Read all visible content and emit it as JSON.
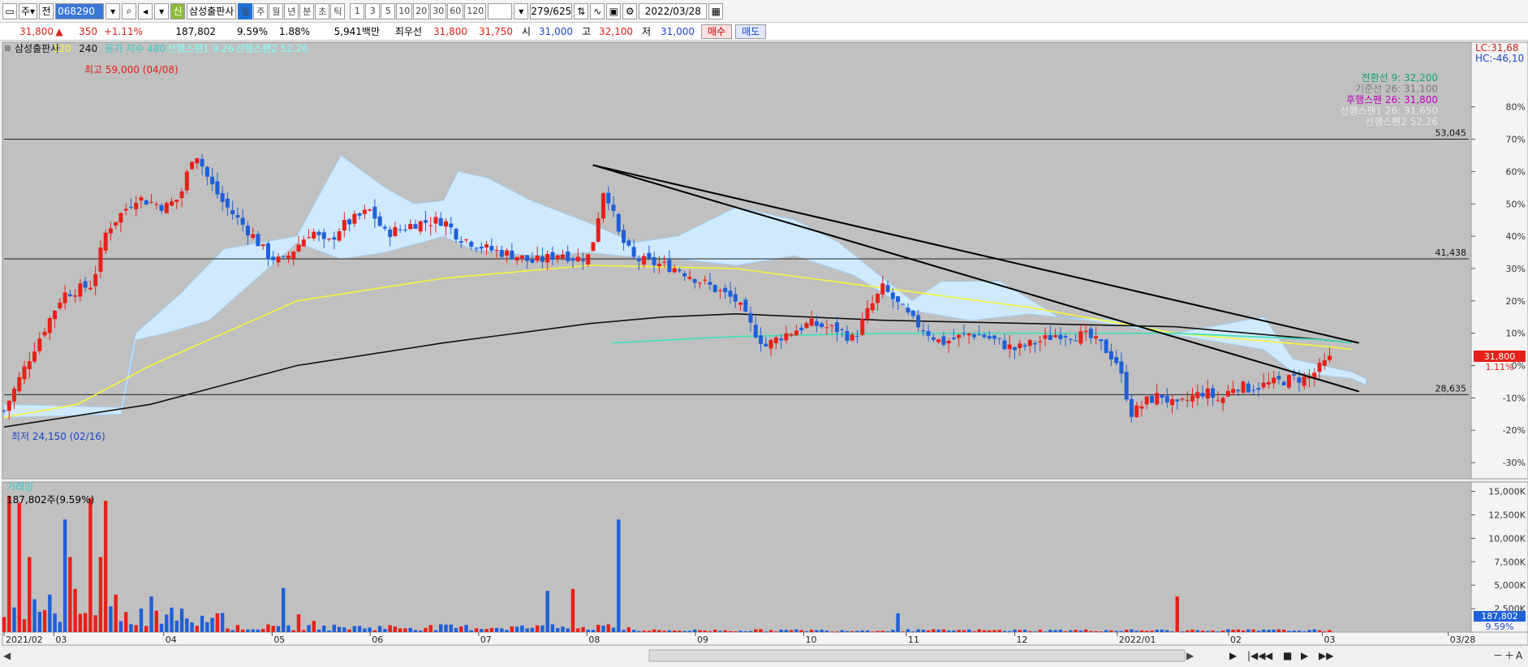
{
  "toolbar": {
    "period_main": "주",
    "all_btn": "전",
    "stock_code": "068290",
    "credit_badge": "신",
    "stock_name": "삼성출판사",
    "periods": [
      "일",
      "주",
      "월",
      "년",
      "분",
      "초",
      "틱"
    ],
    "active_period": "일",
    "intervals": [
      "1",
      "3",
      "5",
      "10",
      "20",
      "30",
      "60",
      "120"
    ],
    "range": "279/625",
    "date": "2022/03/28"
  },
  "quote": {
    "price": "31,800",
    "change": "350",
    "change_pct": "+1.11%",
    "volume": "187,802",
    "turnover_pct": "9.59%",
    "vol_ratio": "1.88%",
    "amount": "5,941백만",
    "priority_label": "최우선",
    "ask": "31,800",
    "bid": "31,750",
    "open_label": "시",
    "open": "31,000",
    "high_label": "고",
    "high": "32,100",
    "low_label": "저",
    "low": "31,000",
    "buy_label": "매수",
    "sell_label": "매도"
  },
  "colors": {
    "up": "#e8201a",
    "down": "#1f5fd8",
    "panel": "#c0c0c0",
    "cloud": "#cfe9ff",
    "ma120": "#f5f53c",
    "ma240": "#111111",
    "ma_eq": "#3ce0b8",
    "legend_cloud": "#80ffff"
  },
  "chart_data": {
    "type": "candlestick",
    "price_panel": {
      "legend": [
        "삼성출판사",
        "120",
        "240",
        "등가 지수 480",
        "선행스팬1 9.26",
        "선행스팬2 52.26"
      ],
      "ylim_pct": [
        -35,
        100
      ],
      "right_ticks": [
        "80%",
        "70%",
        "60%",
        "50%",
        "40%",
        "30%",
        "20%",
        "10%",
        "0%",
        "-10%",
        "-20%",
        "-30%"
      ],
      "corner_labels": [
        "LC:31,68",
        "HC:-46,10"
      ],
      "horizontal_lines": [
        {
          "label": "53,045",
          "pct": 70
        },
        {
          "label": "41,438",
          "pct": 33
        },
        {
          "label": "28,635",
          "pct": -9
        }
      ],
      "ichimoku_text": [
        {
          "text": "전환선 9: 32,200",
          "color": "#16a070"
        },
        {
          "text": "기준선 26: 31,100",
          "color": "#7a7a7a"
        },
        {
          "text": "후행스팬 26: 31,800",
          "color": "#c000c0"
        },
        {
          "text": "선행스팬1 26: 31,650",
          "color": "#e8e8e8"
        },
        {
          "text": "선행스팬2 52,26",
          "color": "#e8e8e8"
        }
      ],
      "annotations": {
        "high": "최고 59,000 (04/08)",
        "low": "최저 24,150 (02/16)"
      },
      "current": {
        "price": "31,800",
        "pct": "1.11%"
      },
      "trendlines": [
        [
          0.402,
          62,
          0.925,
          -8
        ],
        [
          0.402,
          62,
          0.925,
          7
        ]
      ],
      "anchors": [
        [
          0,
          -14
        ],
        [
          0.02,
          5
        ],
        [
          0.04,
          22
        ],
        [
          0.06,
          25
        ],
        [
          0.07,
          42
        ],
        [
          0.09,
          52
        ],
        [
          0.11,
          49
        ],
        [
          0.12,
          52
        ],
        [
          0.13,
          67
        ],
        [
          0.14,
          57
        ],
        [
          0.15,
          50
        ],
        [
          0.17,
          40
        ],
        [
          0.18,
          34
        ],
        [
          0.19,
          32
        ],
        [
          0.21,
          42
        ],
        [
          0.22,
          37
        ],
        [
          0.23,
          43
        ],
        [
          0.25,
          48
        ],
        [
          0.26,
          41
        ],
        [
          0.27,
          42
        ],
        [
          0.28,
          44
        ],
        [
          0.3,
          45
        ],
        [
          0.31,
          40
        ],
        [
          0.32,
          38
        ],
        [
          0.33,
          36
        ],
        [
          0.35,
          34
        ],
        [
          0.36,
          32
        ],
        [
          0.37,
          33
        ],
        [
          0.38,
          35
        ],
        [
          0.39,
          33
        ],
        [
          0.4,
          34
        ],
        [
          0.41,
          56
        ],
        [
          0.42,
          40
        ],
        [
          0.43,
          33
        ],
        [
          0.46,
          30
        ],
        [
          0.48,
          25
        ],
        [
          0.5,
          20
        ],
        [
          0.51,
          12
        ],
        [
          0.52,
          6
        ],
        [
          0.53,
          9
        ],
        [
          0.55,
          13
        ],
        [
          0.57,
          11
        ],
        [
          0.58,
          8
        ],
        [
          0.59,
          17
        ],
        [
          0.6,
          24
        ],
        [
          0.61,
          19
        ],
        [
          0.62,
          14
        ],
        [
          0.64,
          7
        ],
        [
          0.66,
          10
        ],
        [
          0.67,
          9
        ],
        [
          0.69,
          5
        ],
        [
          0.71,
          8
        ],
        [
          0.72,
          10
        ],
        [
          0.74,
          9
        ],
        [
          0.75,
          6
        ],
        [
          0.76,
          1
        ],
        [
          0.77,
          -15
        ],
        [
          0.78,
          -11
        ],
        [
          0.79,
          -9
        ],
        [
          0.8,
          -13
        ],
        [
          0.81,
          -10
        ],
        [
          0.82,
          -8
        ],
        [
          0.83,
          -11
        ],
        [
          0.84,
          -6
        ],
        [
          0.85,
          -7
        ],
        [
          0.87,
          -5
        ],
        [
          0.88,
          -4
        ],
        [
          0.89,
          -4
        ],
        [
          0.895,
          -2
        ],
        [
          0.905,
          2
        ]
      ],
      "ma120": [
        [
          0,
          -16
        ],
        [
          0.05,
          -12
        ],
        [
          0.1,
          0
        ],
        [
          0.15,
          10
        ],
        [
          0.2,
          20
        ],
        [
          0.3,
          27
        ],
        [
          0.4,
          31
        ],
        [
          0.5,
          30
        ],
        [
          0.6,
          24
        ],
        [
          0.7,
          18
        ],
        [
          0.75,
          14
        ],
        [
          0.8,
          10
        ],
        [
          0.85,
          8
        ],
        [
          0.9,
          6
        ],
        [
          0.92,
          5
        ]
      ],
      "ma240": [
        [
          0,
          -19
        ],
        [
          0.1,
          -12
        ],
        [
          0.15,
          -6
        ],
        [
          0.2,
          0
        ],
        [
          0.3,
          7
        ],
        [
          0.4,
          13
        ],
        [
          0.45,
          15
        ],
        [
          0.5,
          16
        ],
        [
          0.6,
          14
        ],
        [
          0.7,
          13
        ],
        [
          0.8,
          12
        ],
        [
          0.85,
          10
        ],
        [
          0.9,
          8
        ],
        [
          0.92,
          7
        ]
      ],
      "ma_eq": [
        [
          0.415,
          7
        ],
        [
          0.5,
          9
        ],
        [
          0.6,
          10
        ],
        [
          0.7,
          10
        ],
        [
          0.75,
          10
        ],
        [
          0.8,
          10
        ],
        [
          0.85,
          9
        ],
        [
          0.9,
          8
        ],
        [
          0.92,
          7
        ]
      ],
      "cloud_top": [
        [
          0,
          -12
        ],
        [
          0.08,
          -13
        ],
        [
          0.09,
          10
        ],
        [
          0.12,
          22
        ],
        [
          0.15,
          36
        ],
        [
          0.2,
          40
        ],
        [
          0.23,
          65
        ],
        [
          0.26,
          55
        ],
        [
          0.28,
          50
        ],
        [
          0.3,
          51
        ],
        [
          0.31,
          60
        ],
        [
          0.33,
          58
        ],
        [
          0.36,
          51
        ],
        [
          0.4,
          44
        ],
        [
          0.43,
          38
        ],
        [
          0.46,
          40
        ],
        [
          0.5,
          49
        ],
        [
          0.54,
          45
        ],
        [
          0.57,
          38
        ],
        [
          0.6,
          27
        ],
        [
          0.62,
          20
        ],
        [
          0.64,
          26
        ],
        [
          0.68,
          26
        ],
        [
          0.72,
          15
        ],
        [
          0.76,
          14
        ],
        [
          0.8,
          10
        ],
        [
          0.86,
          15
        ],
        [
          0.88,
          2
        ],
        [
          0.92,
          -2
        ],
        [
          0.93,
          -4
        ]
      ],
      "cloud_bot": [
        [
          0,
          -16
        ],
        [
          0.08,
          -15
        ],
        [
          0.09,
          8
        ],
        [
          0.11,
          10
        ],
        [
          0.14,
          14
        ],
        [
          0.2,
          38
        ],
        [
          0.23,
          33
        ],
        [
          0.26,
          35
        ],
        [
          0.3,
          40
        ],
        [
          0.32,
          36
        ],
        [
          0.36,
          34
        ],
        [
          0.4,
          35
        ],
        [
          0.42,
          34
        ],
        [
          0.46,
          33
        ],
        [
          0.5,
          31
        ],
        [
          0.54,
          34
        ],
        [
          0.58,
          28
        ],
        [
          0.62,
          17
        ],
        [
          0.66,
          14
        ],
        [
          0.7,
          16
        ],
        [
          0.74,
          14
        ],
        [
          0.78,
          11
        ],
        [
          0.82,
          8
        ],
        [
          0.86,
          5
        ],
        [
          0.88,
          -2
        ],
        [
          0.92,
          -4
        ],
        [
          0.93,
          -6
        ]
      ]
    },
    "volume_panel": {
      "label": "거래량",
      "current": "187,802주(9.59%)",
      "right_ticks": [
        "15,000K",
        "12,500K",
        "10,000K",
        "7,500K",
        "5,000K",
        "2,500K"
      ],
      "ylim_k": [
        0,
        16000
      ],
      "current_labels": [
        "187,802",
        "9.59%"
      ],
      "spikes": [
        [
          0.005,
          14500
        ],
        [
          0.01,
          13800
        ],
        [
          0.016,
          8000
        ],
        [
          0.02,
          3500
        ],
        [
          0.03,
          4000
        ],
        [
          0.04,
          12000
        ],
        [
          0.045,
          8000
        ],
        [
          0.05,
          4600
        ],
        [
          0.06,
          14300
        ],
        [
          0.065,
          8000
        ],
        [
          0.07,
          14000
        ],
        [
          0.075,
          4000
        ],
        [
          0.1,
          3800
        ],
        [
          0.19,
          4700
        ],
        [
          0.2,
          1900
        ],
        [
          0.21,
          1200
        ],
        [
          0.37,
          4400
        ],
        [
          0.39,
          4600
        ],
        [
          0.42,
          12000
        ],
        [
          0.61,
          2000
        ],
        [
          0.8,
          3800
        ],
        [
          0.915,
          2000
        ]
      ]
    },
    "x_labels": [
      "2021/02",
      "03",
      "04",
      "05",
      "06",
      "07",
      "08",
      "09",
      "10",
      "11",
      "12",
      "2022/01",
      "02",
      "03",
      "03/28"
    ],
    "x_positions": [
      0.0,
      0.034,
      0.109,
      0.183,
      0.25,
      0.324,
      0.398,
      0.472,
      0.546,
      0.616,
      0.69,
      0.76,
      0.836,
      0.9,
      0.986
    ]
  },
  "bottom_nav": {
    "buttons": [
      "▶",
      "|◀◀",
      "◀",
      "■",
      "▶",
      "▶▶"
    ],
    "zoom": [
      "－",
      "＋",
      "A"
    ]
  }
}
